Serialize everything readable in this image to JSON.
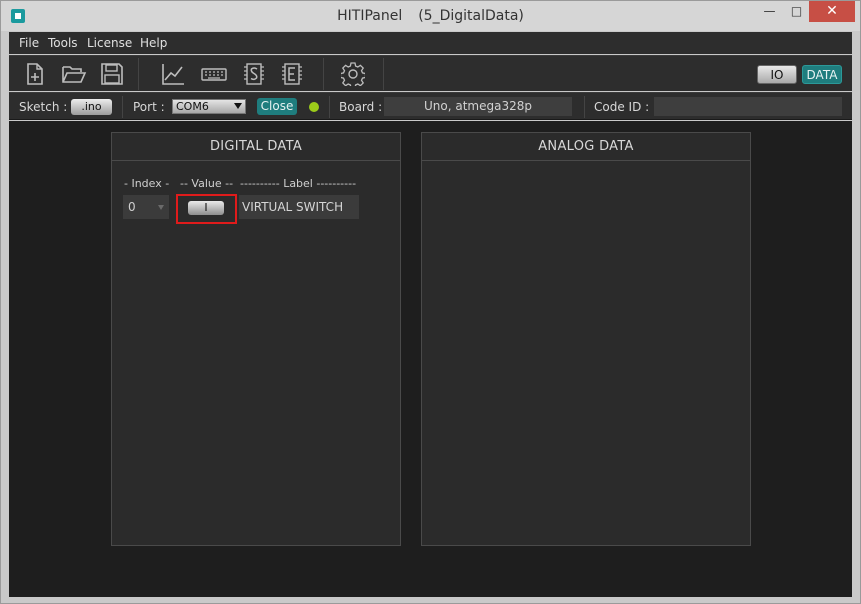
{
  "window": {
    "title": "HITIPanel",
    "subtitle": "(5_DigitalData)",
    "min_glyph": "—",
    "max_glyph": "□",
    "close_glyph": "✕"
  },
  "menu": {
    "items": [
      "File",
      "Tools",
      "License",
      "Help"
    ]
  },
  "toolbar": {
    "icons": [
      "new-file-icon",
      "open-folder-icon",
      "save-icon",
      "chart-icon",
      "keyboard-icon",
      "sketch-s-icon",
      "eeprom-e-icon",
      "settings-gear-icon"
    ],
    "io_label": "IO",
    "data_label": "DATA"
  },
  "status": {
    "sketch_label": "Sketch :",
    "sketch_button": ".ino",
    "port_label": "Port :",
    "port_value": "COM6",
    "close_button": "Close",
    "led_color": "#9ccc1a",
    "board_label": "Board :",
    "board_value": "Uno, atmega328p",
    "codeid_label": "Code ID :",
    "codeid_value": ""
  },
  "digital": {
    "title": "DIGITAL  DATA",
    "col_index": "- Index -",
    "col_value": "-- Value --",
    "col_label": "---------- Label ----------",
    "rows": [
      {
        "index": "0",
        "value_button": "I",
        "label": "VIRTUAL SWITCH"
      }
    ]
  },
  "analog": {
    "title": "ANALOG  DATA"
  },
  "colors": {
    "accent": "#1f7d7e",
    "highlight": "#e01b1b",
    "background": "#1e1e1e",
    "panel": "#2b2b2b"
  }
}
